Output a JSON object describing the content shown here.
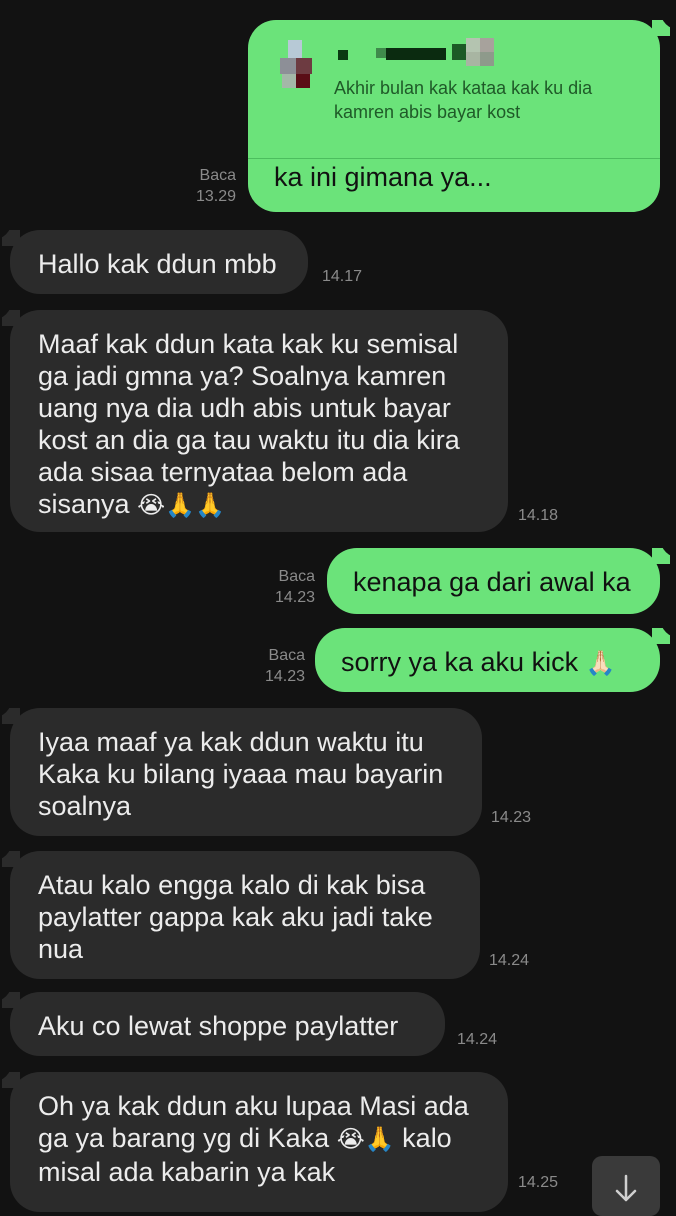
{
  "reply": {
    "quoted_text": "Akhir bulan kak kataa kak ku dia kamren abis bayar kost",
    "text": "ka ini gimana ya...",
    "status": "Baca",
    "time": "13.29"
  },
  "messages": [
    {
      "text": "Hallo kak ddun mbb",
      "time": "14.17"
    },
    {
      "text": "Maaf kak ddun kata kak ku semisal ga jadi gmna ya? Soalnya kamren uang nya dia udh abis untuk bayar kost an dia ga tau waktu itu dia kira ada sisaa ternyataa belom ada sisanya",
      "emoji": "😭🙏🙏",
      "time": "14.18"
    },
    {
      "text": "kenapa ga dari awal ka",
      "status": "Baca",
      "time": "14.23"
    },
    {
      "text": "sorry ya ka aku kick",
      "emoji": "🙏🏻",
      "status": "Baca",
      "time": "14.23"
    },
    {
      "text": "Iyaa maaf ya kak ddun waktu itu Kaka ku bilang iyaaa mau bayarin soalnya",
      "time": "14.23"
    },
    {
      "text": "Atau kalo engga kalo di kak bisa paylatter gappa kak aku jadi take nua",
      "time": "14.24"
    },
    {
      "text": "Aku co lewat shoppe paylatter",
      "time": "14.24"
    },
    {
      "text_a": "Oh ya kak ddun aku lupaa Masi ada ga ya barang yg di Kaka",
      "emoji_a": "😭🙏",
      "text_b": "kalo misal ada kabarin ya kak",
      "time": "14.25"
    }
  ],
  "colors": {
    "background": "#121212",
    "incoming_bubble": "#2b2b2b",
    "outgoing_bubble": "#6be37a",
    "meta_text": "#8a8a8a"
  },
  "icons": {
    "scroll_down": "arrow-down-icon"
  }
}
